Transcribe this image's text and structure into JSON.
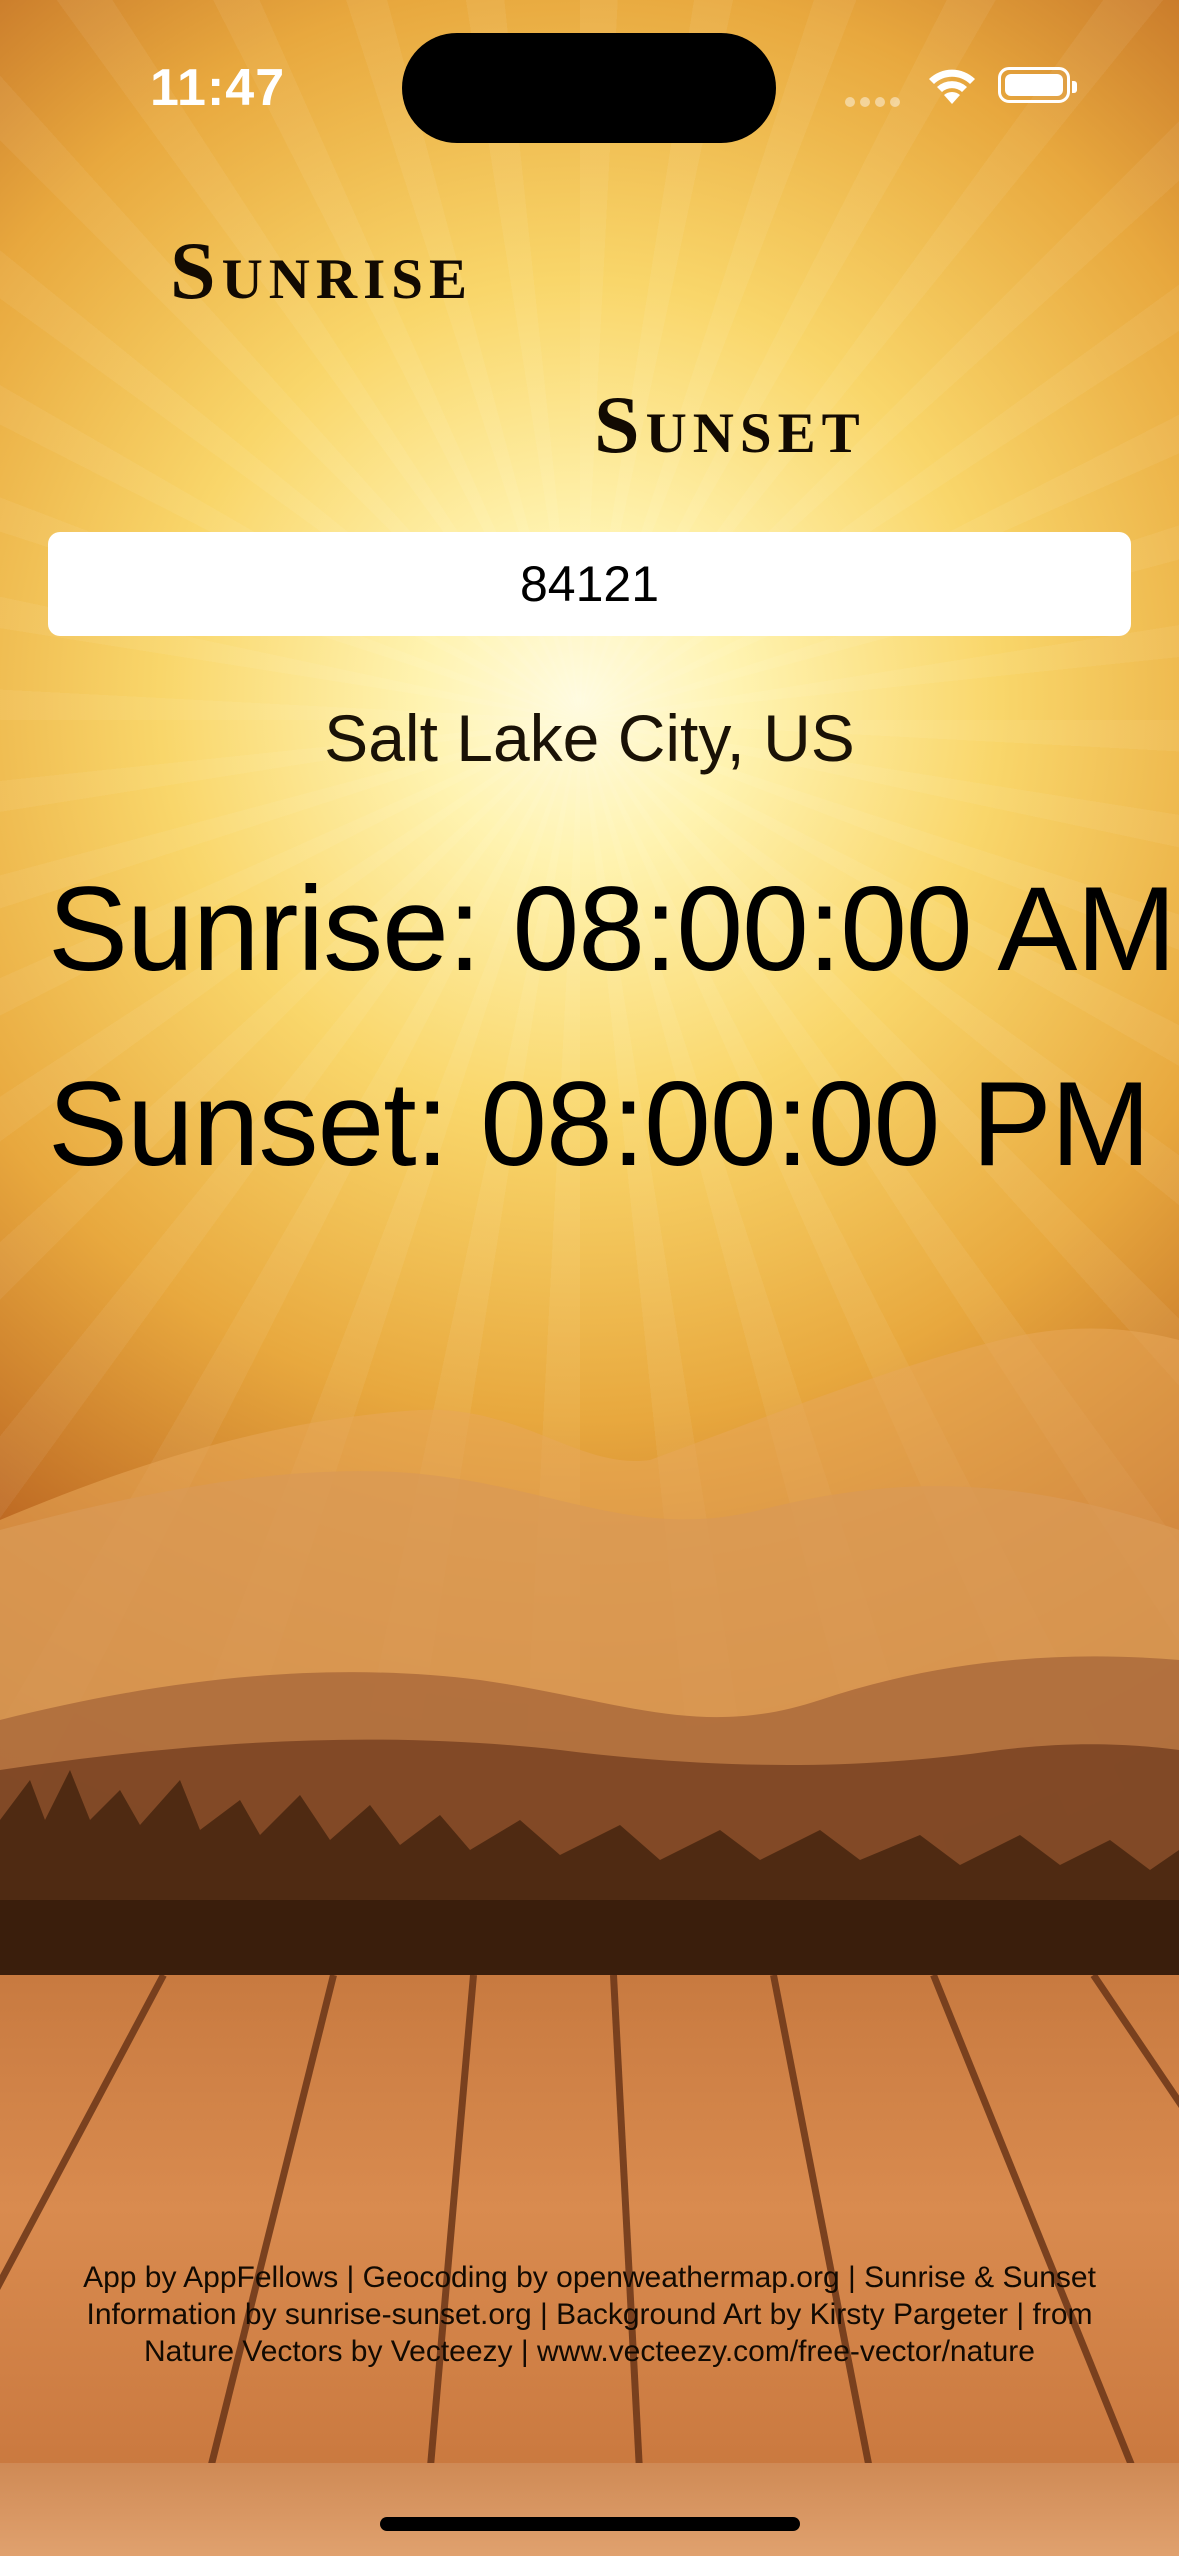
{
  "status_bar": {
    "time": "11:47"
  },
  "header": {
    "title_line1": "Sunrise",
    "title_line2": "Sunset"
  },
  "search": {
    "zip_value": "84121"
  },
  "result": {
    "location": "Salt Lake City, US",
    "sunrise": "Sunrise: 08:00:00 AM",
    "sunset": "Sunset: 08:00:00 PM"
  },
  "footer": {
    "credits": "App by AppFellows | Geocoding by openweathermap.org | Sunrise & Sunset Information by sunrise-sunset.org | Background Art by Kirsty Pargeter | from Nature Vectors by Vecteezy | www.vecteezy.com/free-vector/nature"
  },
  "colors": {
    "title_text": "#120a02",
    "input_bg": "#ffffff",
    "sky_center": "#fffbe0",
    "sky_edge": "#5a2b0f"
  },
  "icons": [
    "wifi-icon",
    "battery-icon",
    "signal-dots-icon"
  ]
}
